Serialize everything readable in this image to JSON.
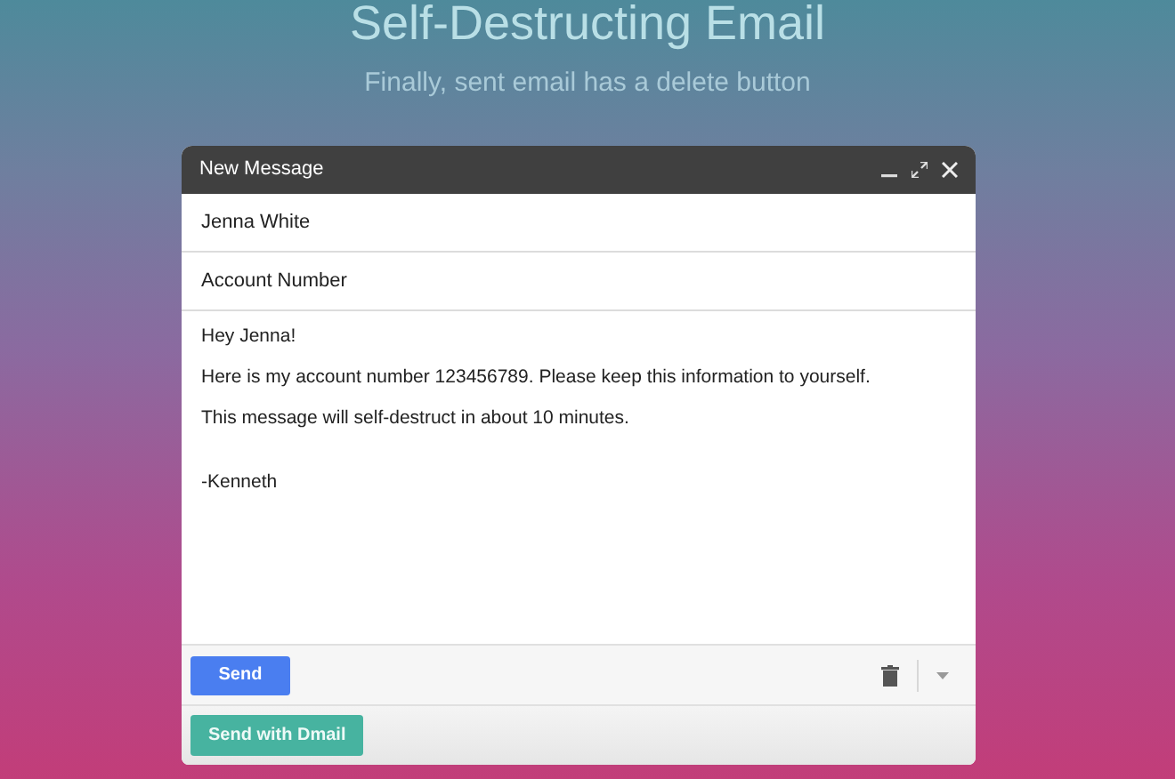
{
  "hero": {
    "title": "Self-Destructing Email",
    "subtitle": "Finally, sent email has a delete button"
  },
  "compose": {
    "title": "New Message",
    "to": "Jenna White",
    "subject": "Account Number",
    "body": [
      "Hey Jenna!",
      "Here is my account number 123456789. Please keep this information to yourself.",
      "This message will self-destruct in about 10 minutes."
    ],
    "signature": "-Kenneth",
    "send_button": "Send",
    "dmall_button": "Send with Dmail"
  }
}
